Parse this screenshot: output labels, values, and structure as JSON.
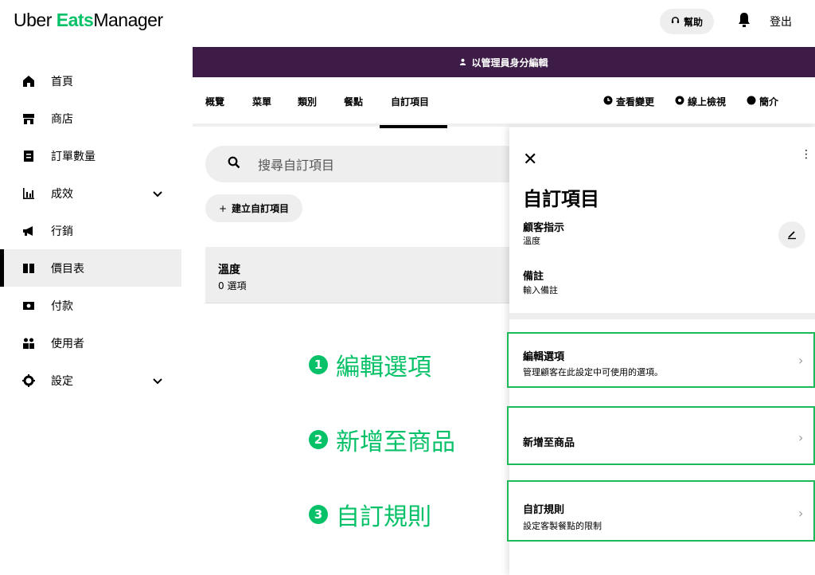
{
  "header": {
    "logo_uber": "Uber",
    "logo_eats": "Eats",
    "logo_manager": "Manager",
    "help_label": "幫助",
    "logout_label": "登出"
  },
  "sidebar": {
    "items": [
      {
        "label": "首頁",
        "icon": "home-icon"
      },
      {
        "label": "商店",
        "icon": "store-icon"
      },
      {
        "label": "訂單數量",
        "icon": "receipt-icon"
      },
      {
        "label": "成效",
        "icon": "chart-icon",
        "expandable": true
      },
      {
        "label": "行銷",
        "icon": "megaphone-icon"
      },
      {
        "label": "價目表",
        "icon": "book-icon",
        "active": true
      },
      {
        "label": "付款",
        "icon": "money-icon"
      },
      {
        "label": "使用者",
        "icon": "users-icon"
      },
      {
        "label": "設定",
        "icon": "gear-icon",
        "expandable": true
      }
    ]
  },
  "banner": {
    "text": "以管理員身分編輯"
  },
  "tabs": {
    "items": [
      "概覽",
      "菜單",
      "類別",
      "餐點",
      "自訂項目"
    ],
    "active": "自訂項目",
    "right_links": [
      "查看變更",
      "線上檢視",
      "簡介"
    ]
  },
  "main": {
    "search_placeholder": "搜尋自訂項目",
    "create_label": "建立自訂項目",
    "item": {
      "title": "溫度",
      "subtitle": "0 選項"
    }
  },
  "annotations": [
    {
      "num": "1",
      "text": "編輯選項"
    },
    {
      "num": "2",
      "text": "新增至商品"
    },
    {
      "num": "3",
      "text": "自訂規則"
    }
  ],
  "panel": {
    "title": "自訂項目",
    "customer_label": "顧客指示",
    "customer_value": "溫度",
    "notes_label": "備註",
    "notes_value": "輸入備註",
    "options": [
      {
        "title": "編輯選項",
        "desc": "管理顧客在此設定中可使用的選項。"
      },
      {
        "title": "新增至商品",
        "desc": ""
      },
      {
        "title": "自訂規則",
        "desc": "設定客製餐點的限制"
      }
    ]
  },
  "colors": {
    "brand_green": "#06c167",
    "banner_purple": "#3d1d47",
    "highlight_border": "#1dba5a"
  }
}
